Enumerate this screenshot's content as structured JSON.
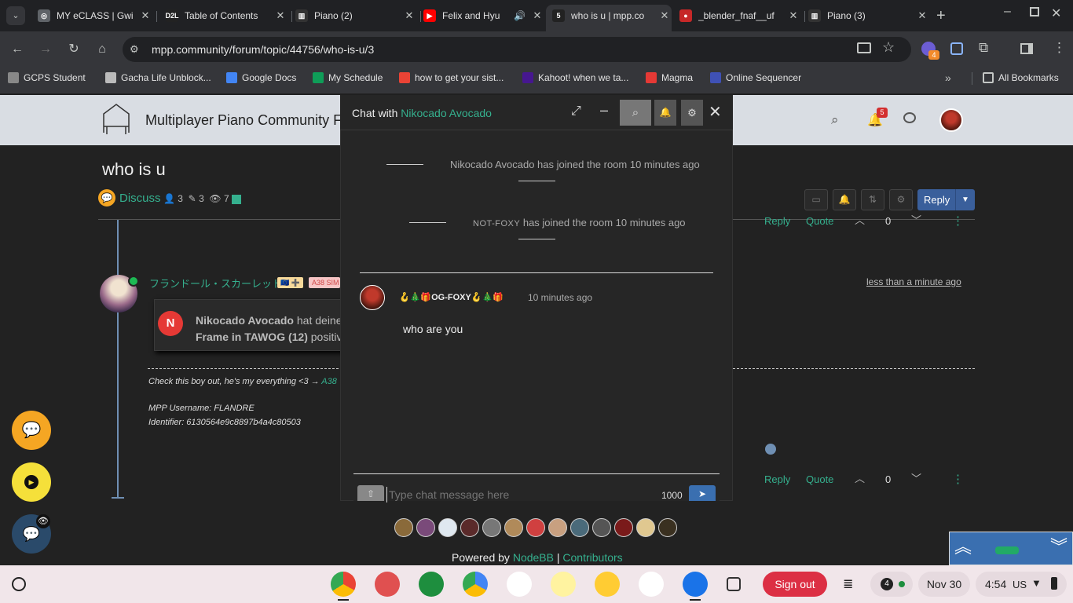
{
  "tabs": [
    {
      "title": "MY eCLASS | Gwi",
      "fav": "#5f6368",
      "favtext": "◎"
    },
    {
      "title": "Table of Contents",
      "fav": "#222",
      "favtext": "D2L"
    },
    {
      "title": "Piano (2)",
      "fav": "#333",
      "favtext": "▥"
    },
    {
      "title": "Felix and Hyu",
      "fav": "#ff0000",
      "favtext": "▶"
    },
    {
      "title": "who is u | mpp.co",
      "fav": "#222",
      "favtext": "5"
    },
    {
      "title": "_blender_fnaf__uf",
      "fav": "#c62828",
      "favtext": "●"
    },
    {
      "title": "Piano (3)",
      "fav": "#333",
      "favtext": "▥"
    }
  ],
  "url": "mpp.community/forum/topic/44756/who-is-u/3",
  "bookmarks": [
    {
      "label": "GCPS Student",
      "color": "#888"
    },
    {
      "label": "Gacha Life Unblock...",
      "color": "#bbb"
    },
    {
      "label": "Google Docs",
      "color": "#4285f4"
    },
    {
      "label": "My Schedule",
      "color": "#0f9d58"
    },
    {
      "label": "how to get your sist...",
      "color": "#ea4335"
    },
    {
      "label": "Kahoot! when we ta...",
      "color": "#46178f"
    },
    {
      "label": "Magma",
      "color": "#e53935"
    },
    {
      "label": "Online Sequencer",
      "color": "#3f51b5"
    }
  ],
  "all_bookmarks": "All Bookmarks",
  "extension_badge": "4",
  "site": {
    "title": "Multiplayer Piano Community Fo",
    "notif_count": "5"
  },
  "topic": {
    "title": "who is u",
    "category": "Discuss",
    "posters": "3",
    "posts": "3",
    "views": "7",
    "reply_label": "Reply"
  },
  "post": {
    "author": "フランドール・スカーレット",
    "badge1": "🇪🇺 ➕",
    "badge2": "A38 SIM",
    "timestamp": "less than a minute ago",
    "notif_name": "Nikocado Avocado",
    "notif_text": " hat deinen",
    "notif_line2": "Frame in TAWOG (12)",
    "notif_line2b": " positiv",
    "sig_line1": "Check this boy out, he's my everything <3 → ",
    "sig_link": "A38",
    "sig_line2": "MPP Username: FLANDRE",
    "sig_line3": "Identifier: 6130564e9c8897b4a4c80503",
    "reply": "Reply",
    "quote": "Quote",
    "votes": "0"
  },
  "prev_post": {
    "reply": "Reply",
    "quote": "Quote",
    "votes": "0"
  },
  "chat": {
    "title_prefix": "Chat with ",
    "title_name": "Nikocado Avocado",
    "sys1": "Nikocado Avocado has joined the room 10 minutes ago",
    "sys2_name": "NOT-FOXY",
    "sys2_rest": " has joined the room 10 minutes ago",
    "msg_user": "🪝🎄🎁OG-FOXY🪝🎄🎁",
    "msg_time": "10 minutes ago",
    "msg_text": "who are you",
    "input_placeholder": "Type chat message here",
    "char_count": "1000"
  },
  "footer": {
    "powered": "Powered by ",
    "nodebb": "NodeBB",
    "sep": " | ",
    "contributors": "Contributors"
  },
  "shelf": {
    "sign_out": "Sign out",
    "date": "Nov 30",
    "time": "4:54",
    "region": "US",
    "notif": "4"
  }
}
